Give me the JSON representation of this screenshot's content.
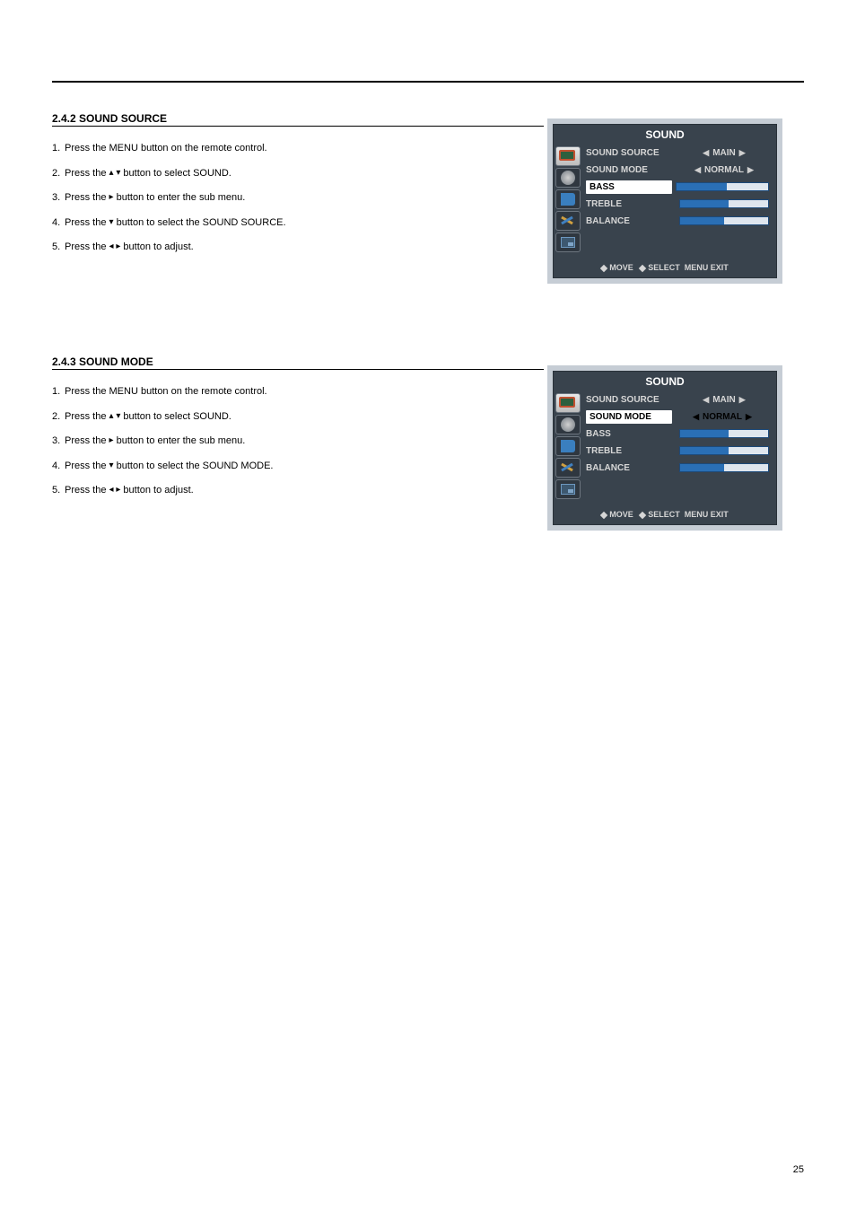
{
  "page_number": "25",
  "section1": {
    "title": "2.4.2 SOUND SOURCE",
    "steps": [
      {
        "num": "1.",
        "text_before": "Press the MENU button on the remote control."
      },
      {
        "num": "2.",
        "text_before": "Press the ",
        "arrows": "▴ ▾",
        "text_after": " button to select SOUND."
      },
      {
        "num": "3.",
        "text_before": "Press the ",
        "arrows": "▸",
        "text_after": " button to enter the sub menu."
      },
      {
        "num": "4.",
        "text_before": "Press the ",
        "arrows": "▾",
        "text_after": " button to select the SOUND SOURCE."
      },
      {
        "num": "5.",
        "text_before": "Press the ",
        "arrows": "◂ ▸",
        "text_after": " button to adjust."
      }
    ]
  },
  "section2": {
    "title": "2.4.3 SOUND MODE",
    "steps": [
      {
        "num": "1.",
        "text_before": "Press the MENU button on the remote control."
      },
      {
        "num": "2.",
        "text_before": "Press the ",
        "arrows": "▴ ▾",
        "text_after": " button to select SOUND."
      },
      {
        "num": "3.",
        "text_before": "Press the ",
        "arrows": "▸",
        "text_after": " button to enter the sub menu."
      },
      {
        "num": "4.",
        "text_before": "Press the ",
        "arrows": "▾",
        "text_after": " button to select the SOUND MODE."
      },
      {
        "num": "5.",
        "text_before": "Press the ",
        "arrows": "◂ ▸",
        "text_after": " button to adjust."
      }
    ]
  },
  "osd": {
    "title": "SOUND",
    "rows": {
      "sound_source": "SOUND SOURCE",
      "sound_source_val": "MAIN",
      "sound_mode": "SOUND MODE",
      "sound_mode_val": "NORMAL",
      "bass": "BASS",
      "treble": "TREBLE",
      "balance": "BALANCE"
    },
    "footer": {
      "move": "MOVE",
      "select": "SELECT",
      "menu": "MENU",
      "exit": "EXIT"
    },
    "slider_fill": {
      "bass": 55,
      "treble": 55,
      "balance": 52
    }
  }
}
